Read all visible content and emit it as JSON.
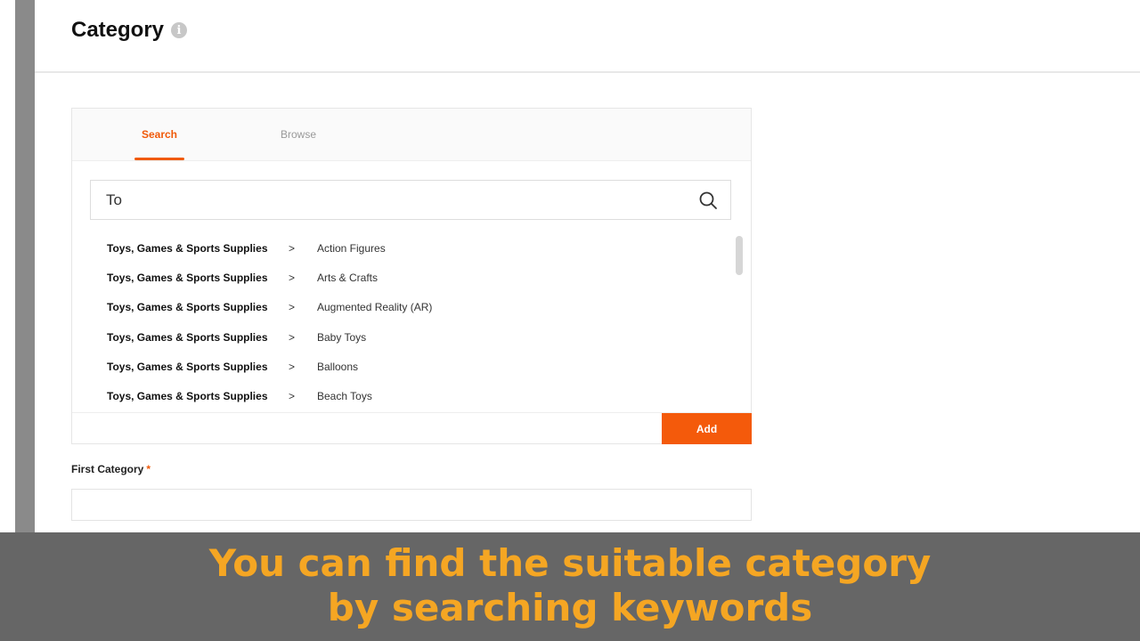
{
  "header": {
    "title": "Category",
    "info_icon": "info-icon"
  },
  "tabs": [
    {
      "label": "Search",
      "active": true
    },
    {
      "label": "Browse",
      "active": false
    }
  ],
  "search": {
    "value": "To",
    "placeholder": "",
    "icon": "search-icon"
  },
  "results": [
    {
      "parent": "Toys, Games & Sports Supplies",
      "separator": ">",
      "child": "Action Figures"
    },
    {
      "parent": "Toys, Games & Sports Supplies",
      "separator": ">",
      "child": "Arts & Crafts"
    },
    {
      "parent": "Toys, Games & Sports Supplies",
      "separator": ">",
      "child": "Augmented Reality (AR)"
    },
    {
      "parent": "Toys, Games & Sports Supplies",
      "separator": ">",
      "child": "Baby Toys"
    },
    {
      "parent": "Toys, Games & Sports Supplies",
      "separator": ">",
      "child": "Balloons"
    },
    {
      "parent": "Toys, Games & Sports Supplies",
      "separator": ">",
      "child": "Beach Toys"
    }
  ],
  "actions": {
    "add_label": "Add"
  },
  "form": {
    "first_category_label": "First Category",
    "required_mark": "*",
    "first_category_value": ""
  },
  "caption": {
    "line1": "You can find the suitable category",
    "line2": "by searching keywords"
  },
  "colors": {
    "accent": "#f05a0a",
    "caption_text": "#f5a623",
    "caption_bg": "#666666"
  }
}
